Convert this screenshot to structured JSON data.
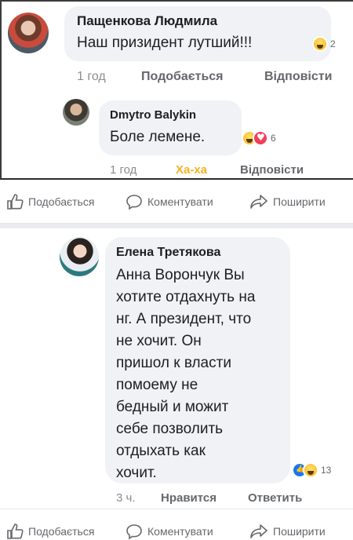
{
  "comments_top": {
    "c1": {
      "author": "Пащенкова Людмила",
      "text": "Наш призидент лутший!!!",
      "reaction_count": "2",
      "time": "1 год",
      "like": "Подобається",
      "reply": "Відповісти",
      "reactions": [
        "laugh-emoji"
      ]
    },
    "c2": {
      "author": "Dmytro Balykin",
      "text": "Боле лемене.",
      "reaction_count": "6",
      "time": "1 год",
      "like": "Ха-ха",
      "reply": "Відповісти",
      "reactions": [
        "laugh-emoji",
        "love-emoji"
      ],
      "like_color": "#f7b125"
    }
  },
  "action_bar": {
    "like": "Подобається",
    "comment": "Коментувати",
    "share": "Поширити"
  },
  "comment_bottom": {
    "author": "Елена Третякова",
    "lines": [
      "Анна Ворончук  Вы",
      "хотите отдахнуть на",
      "нг. А президент, что",
      "не хочит. Он",
      "пришол к власти",
      "помоему не",
      "бедный и можит",
      "себе позволить",
      "отдыхать как",
      "хочит."
    ],
    "reaction_count": "13",
    "reactions": [
      "like-emoji",
      "laugh-emoji"
    ],
    "time": "3 ч.",
    "like": "Нравится",
    "reply": "Ответить"
  },
  "colors": {
    "bubble": "#f0f2f5",
    "meta": "#65676b",
    "haha": "#f7b125",
    "link": "#1877f2"
  }
}
